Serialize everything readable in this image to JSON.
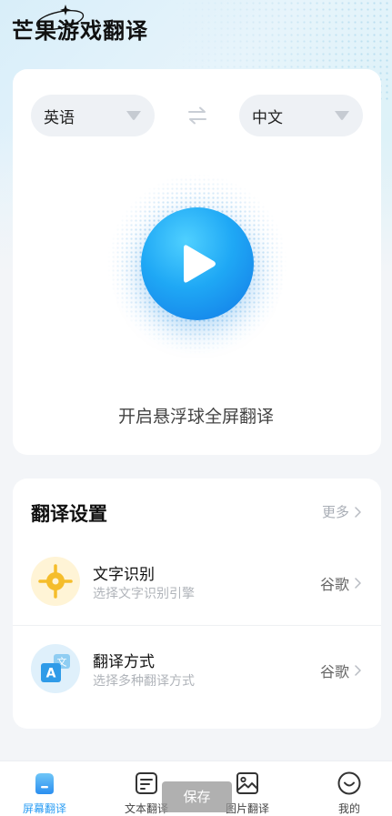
{
  "app": {
    "title": "芒果游戏翻译"
  },
  "languages": {
    "source": "英语",
    "target": "中文"
  },
  "main": {
    "float_caption": "开启悬浮球全屏翻译"
  },
  "settings": {
    "title": "翻译设置",
    "more_label": "更多",
    "rows": [
      {
        "title": "文字识别",
        "subtitle": "选择文字识别引擎",
        "value": "谷歌",
        "icon": "ocr-target-icon"
      },
      {
        "title": "翻译方式",
        "subtitle": "选择多种翻译方式",
        "value": "谷歌",
        "icon": "translate-icon"
      }
    ]
  },
  "nav": {
    "items": [
      {
        "label": "屏幕翻译",
        "icon": "screen-icon",
        "active": true
      },
      {
        "label": "文本翻译",
        "icon": "text-doc-icon",
        "active": false
      },
      {
        "label": "图片翻译",
        "icon": "image-icon",
        "active": false
      },
      {
        "label": "我的",
        "icon": "smile-icon",
        "active": false
      }
    ]
  },
  "toast": {
    "text": "保存"
  },
  "colors": {
    "accent": "#2a9df4",
    "play_gradient_start": "#4fd0ff",
    "play_gradient_end": "#1278e6",
    "ocr_icon_bg": "#fff4d6",
    "ocr_icon_fg": "#f5bd2b",
    "translate_icon_bg": "#dff0fb"
  }
}
